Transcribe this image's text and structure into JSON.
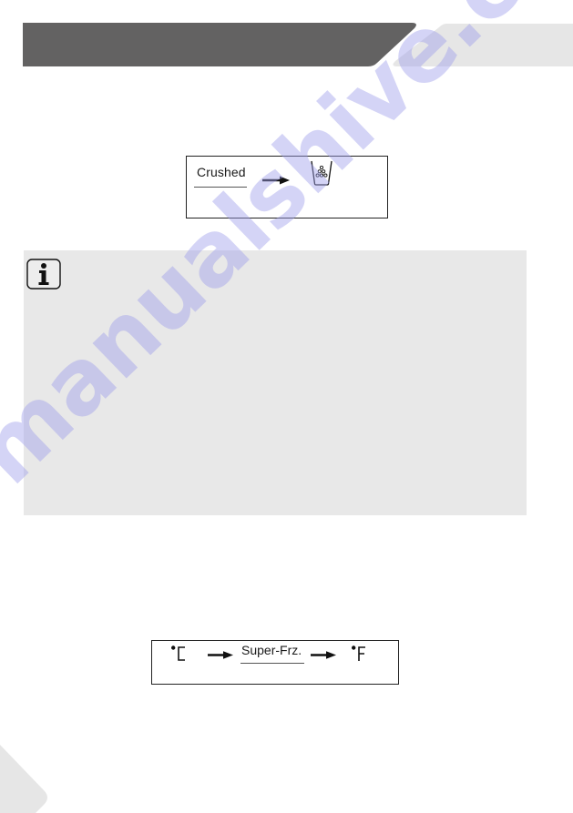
{
  "header": {
    "primary_bar_color": "#636262",
    "secondary_bar_color": "#e6e6e6"
  },
  "crushed_display": {
    "label": "Crushed",
    "arrow_icon": "right-arrow-icon",
    "result_icon": "crushed-ice-cup-icon"
  },
  "info_box": {
    "icon": "info-icon",
    "background_color": "#e8e8e8"
  },
  "superfrz_display": {
    "from_unit": "°C",
    "label": "Super-Frz.",
    "to_unit": "°F",
    "arrow_icon": "right-arrow-icon"
  },
  "watermark": {
    "text": "manualshive.com",
    "color": "#a0a0eb"
  }
}
